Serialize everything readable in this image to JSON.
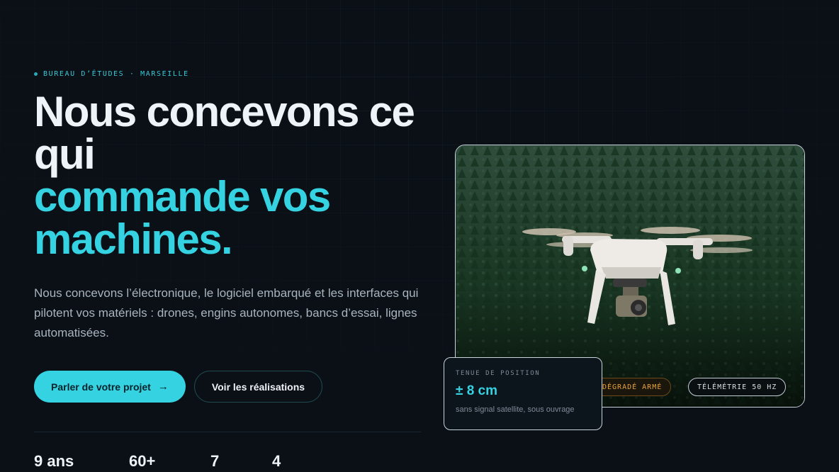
{
  "hero": {
    "eyebrow": "BUREAU D’ÉTUDES · MARSEILLE",
    "title_line1": "Nous concevons ce",
    "title_line2": "qui",
    "title_accent_line1": "commande vos",
    "title_accent_line2": "machines.",
    "lede": "Nous concevons l’électronique, le logiciel embarqué et les interfaces qui pilotent vos matériels : drones, engins autonomes, bancs d’essai, lignes automatisées.",
    "cta_primary": "Parler de votre projet",
    "cta_primary_icon": "arrow-right-icon",
    "cta_secondary": "Voir les réalisations",
    "stats": [
      "9 ans",
      "60+",
      "7",
      "4"
    ]
  },
  "media": {
    "chip_warning": "DÉGRADÉ ARMÉ",
    "chip_telemetry": "TÉLÉMÉTRIE 50 HZ",
    "card_label": "TENUE DE POSITION",
    "card_value": "± 8 cm",
    "card_note": "sans signal satellite, sous ouvrage"
  },
  "colors": {
    "background": "#0a1016",
    "accent": "#35d2e2",
    "warning": "#e8a23a"
  }
}
